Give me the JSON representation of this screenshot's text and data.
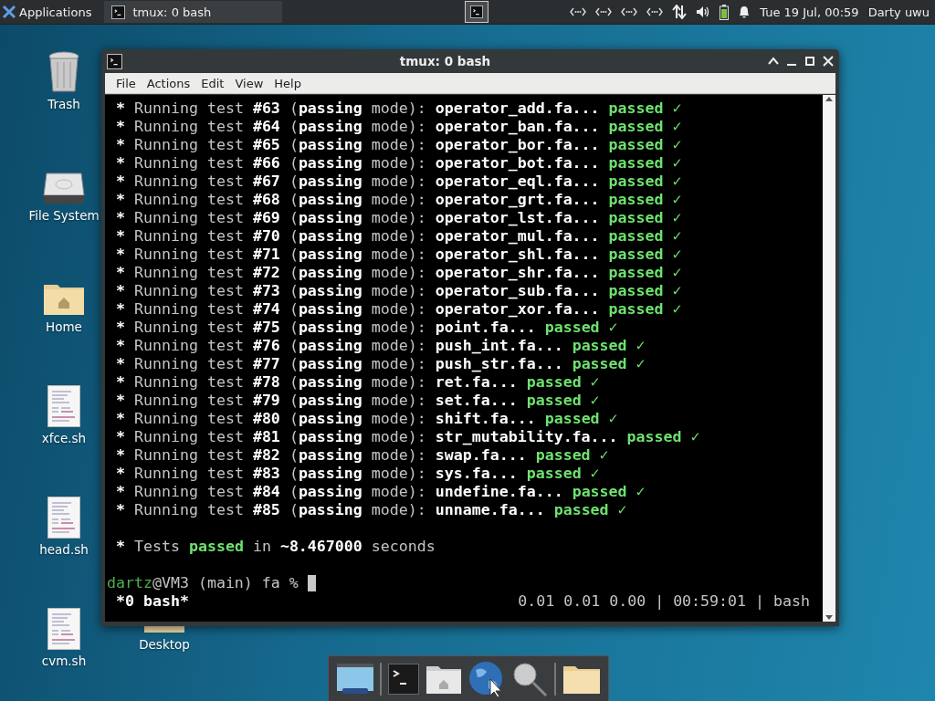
{
  "panel": {
    "applications": "Applications",
    "task": "tmux: 0 bash",
    "clock": "Tue 19 Jul, 00:59",
    "user": "Darty uwu"
  },
  "desktop_icons": [
    {
      "label": "Trash",
      "kind": "trash"
    },
    {
      "label": "File System",
      "kind": "drive"
    },
    {
      "label": "Home",
      "kind": "home"
    },
    {
      "label": "xfce.sh",
      "kind": "script"
    },
    {
      "label": "head.sh",
      "kind": "script"
    },
    {
      "label": "cvm.sh",
      "kind": "script"
    }
  ],
  "hidden_icon": {
    "label": "Desktop",
    "kind": "folder"
  },
  "window": {
    "title": "tmux: 0 bash",
    "menu": [
      "File",
      "Actions",
      "Edit",
      "View",
      "Help"
    ],
    "terminal": {
      "lines": [
        {
          "kind": "test",
          "bullet": "*",
          "label": "Running test",
          "number": "#63",
          "paren": "(",
          "mode": "passing",
          "mode_rest": "mode):",
          "file": "operator_add.fa...",
          "result": "passed ✓"
        },
        {
          "kind": "test",
          "bullet": "*",
          "label": "Running test",
          "number": "#64",
          "paren": "(",
          "mode": "passing",
          "mode_rest": "mode):",
          "file": "operator_ban.fa...",
          "result": "passed ✓"
        },
        {
          "kind": "test",
          "bullet": "*",
          "label": "Running test",
          "number": "#65",
          "paren": "(",
          "mode": "passing",
          "mode_rest": "mode):",
          "file": "operator_bor.fa...",
          "result": "passed ✓"
        },
        {
          "kind": "test",
          "bullet": "*",
          "label": "Running test",
          "number": "#66",
          "paren": "(",
          "mode": "passing",
          "mode_rest": "mode):",
          "file": "operator_bot.fa...",
          "result": "passed ✓"
        },
        {
          "kind": "test",
          "bullet": "*",
          "label": "Running test",
          "number": "#67",
          "paren": "(",
          "mode": "passing",
          "mode_rest": "mode):",
          "file": "operator_eql.fa...",
          "result": "passed ✓"
        },
        {
          "kind": "test",
          "bullet": "*",
          "label": "Running test",
          "number": "#68",
          "paren": "(",
          "mode": "passing",
          "mode_rest": "mode):",
          "file": "operator_grt.fa...",
          "result": "passed ✓"
        },
        {
          "kind": "test",
          "bullet": "*",
          "label": "Running test",
          "number": "#69",
          "paren": "(",
          "mode": "passing",
          "mode_rest": "mode):",
          "file": "operator_lst.fa...",
          "result": "passed ✓"
        },
        {
          "kind": "test",
          "bullet": "*",
          "label": "Running test",
          "number": "#70",
          "paren": "(",
          "mode": "passing",
          "mode_rest": "mode):",
          "file": "operator_mul.fa...",
          "result": "passed ✓"
        },
        {
          "kind": "test",
          "bullet": "*",
          "label": "Running test",
          "number": "#71",
          "paren": "(",
          "mode": "passing",
          "mode_rest": "mode):",
          "file": "operator_shl.fa...",
          "result": "passed ✓"
        },
        {
          "kind": "test",
          "bullet": "*",
          "label": "Running test",
          "number": "#72",
          "paren": "(",
          "mode": "passing",
          "mode_rest": "mode):",
          "file": "operator_shr.fa...",
          "result": "passed ✓"
        },
        {
          "kind": "test",
          "bullet": "*",
          "label": "Running test",
          "number": "#73",
          "paren": "(",
          "mode": "passing",
          "mode_rest": "mode):",
          "file": "operator_sub.fa...",
          "result": "passed ✓"
        },
        {
          "kind": "test",
          "bullet": "*",
          "label": "Running test",
          "number": "#74",
          "paren": "(",
          "mode": "passing",
          "mode_rest": "mode):",
          "file": "operator_xor.fa...",
          "result": "passed ✓"
        },
        {
          "kind": "test",
          "bullet": "*",
          "label": "Running test",
          "number": "#75",
          "paren": "(",
          "mode": "passing",
          "mode_rest": "mode):",
          "file": "point.fa...",
          "result": "passed ✓"
        },
        {
          "kind": "test",
          "bullet": "*",
          "label": "Running test",
          "number": "#76",
          "paren": "(",
          "mode": "passing",
          "mode_rest": "mode):",
          "file": "push_int.fa...",
          "result": "passed ✓"
        },
        {
          "kind": "test",
          "bullet": "*",
          "label": "Running test",
          "number": "#77",
          "paren": "(",
          "mode": "passing",
          "mode_rest": "mode):",
          "file": "push_str.fa...",
          "result": "passed ✓"
        },
        {
          "kind": "test",
          "bullet": "*",
          "label": "Running test",
          "number": "#78",
          "paren": "(",
          "mode": "passing",
          "mode_rest": "mode):",
          "file": "ret.fa...",
          "result": "passed ✓"
        },
        {
          "kind": "test",
          "bullet": "*",
          "label": "Running test",
          "number": "#79",
          "paren": "(",
          "mode": "passing",
          "mode_rest": "mode):",
          "file": "set.fa...",
          "result": "passed ✓"
        },
        {
          "kind": "test",
          "bullet": "*",
          "label": "Running test",
          "number": "#80",
          "paren": "(",
          "mode": "passing",
          "mode_rest": "mode):",
          "file": "shift.fa...",
          "result": "passed ✓"
        },
        {
          "kind": "test",
          "bullet": "*",
          "label": "Running test",
          "number": "#81",
          "paren": "(",
          "mode": "passing",
          "mode_rest": "mode):",
          "file": "str_mutability.fa...",
          "result": "passed ✓"
        },
        {
          "kind": "test",
          "bullet": "*",
          "label": "Running test",
          "number": "#82",
          "paren": "(",
          "mode": "passing",
          "mode_rest": "mode):",
          "file": "swap.fa...",
          "result": "passed ✓"
        },
        {
          "kind": "test",
          "bullet": "*",
          "label": "Running test",
          "number": "#83",
          "paren": "(",
          "mode": "passing",
          "mode_rest": "mode):",
          "file": "sys.fa...",
          "result": "passed ✓"
        },
        {
          "kind": "test",
          "bullet": "*",
          "label": "Running test",
          "number": "#84",
          "paren": "(",
          "mode": "passing",
          "mode_rest": "mode):",
          "file": "undefine.fa...",
          "result": "passed ✓"
        },
        {
          "kind": "test",
          "bullet": "*",
          "label": "Running test",
          "number": "#85",
          "paren": "(",
          "mode": "passing",
          "mode_rest": "mode):",
          "file": "unname.fa...",
          "result": "passed ✓"
        },
        {
          "kind": "blank"
        },
        {
          "kind": "summary",
          "bullet": "*",
          "label": "Tests",
          "result": "passed",
          "middle": "in",
          "duration": "~8.467000",
          "unit": "seconds"
        },
        {
          "kind": "blank"
        },
        {
          "kind": "prompt",
          "user": "dartz",
          "rest": "@VM3 (main) fa %"
        }
      ],
      "status_left": "*0 bash*",
      "status_right": "0.01 0.01 0.00 | 00:59:01 | bash"
    }
  },
  "dock": {
    "items": [
      {
        "kind": "desktop"
      },
      {
        "kind": "separator"
      },
      {
        "kind": "terminal"
      },
      {
        "kind": "home"
      },
      {
        "kind": "globe"
      },
      {
        "kind": "search"
      },
      {
        "kind": "separator"
      },
      {
        "kind": "folder"
      }
    ]
  }
}
